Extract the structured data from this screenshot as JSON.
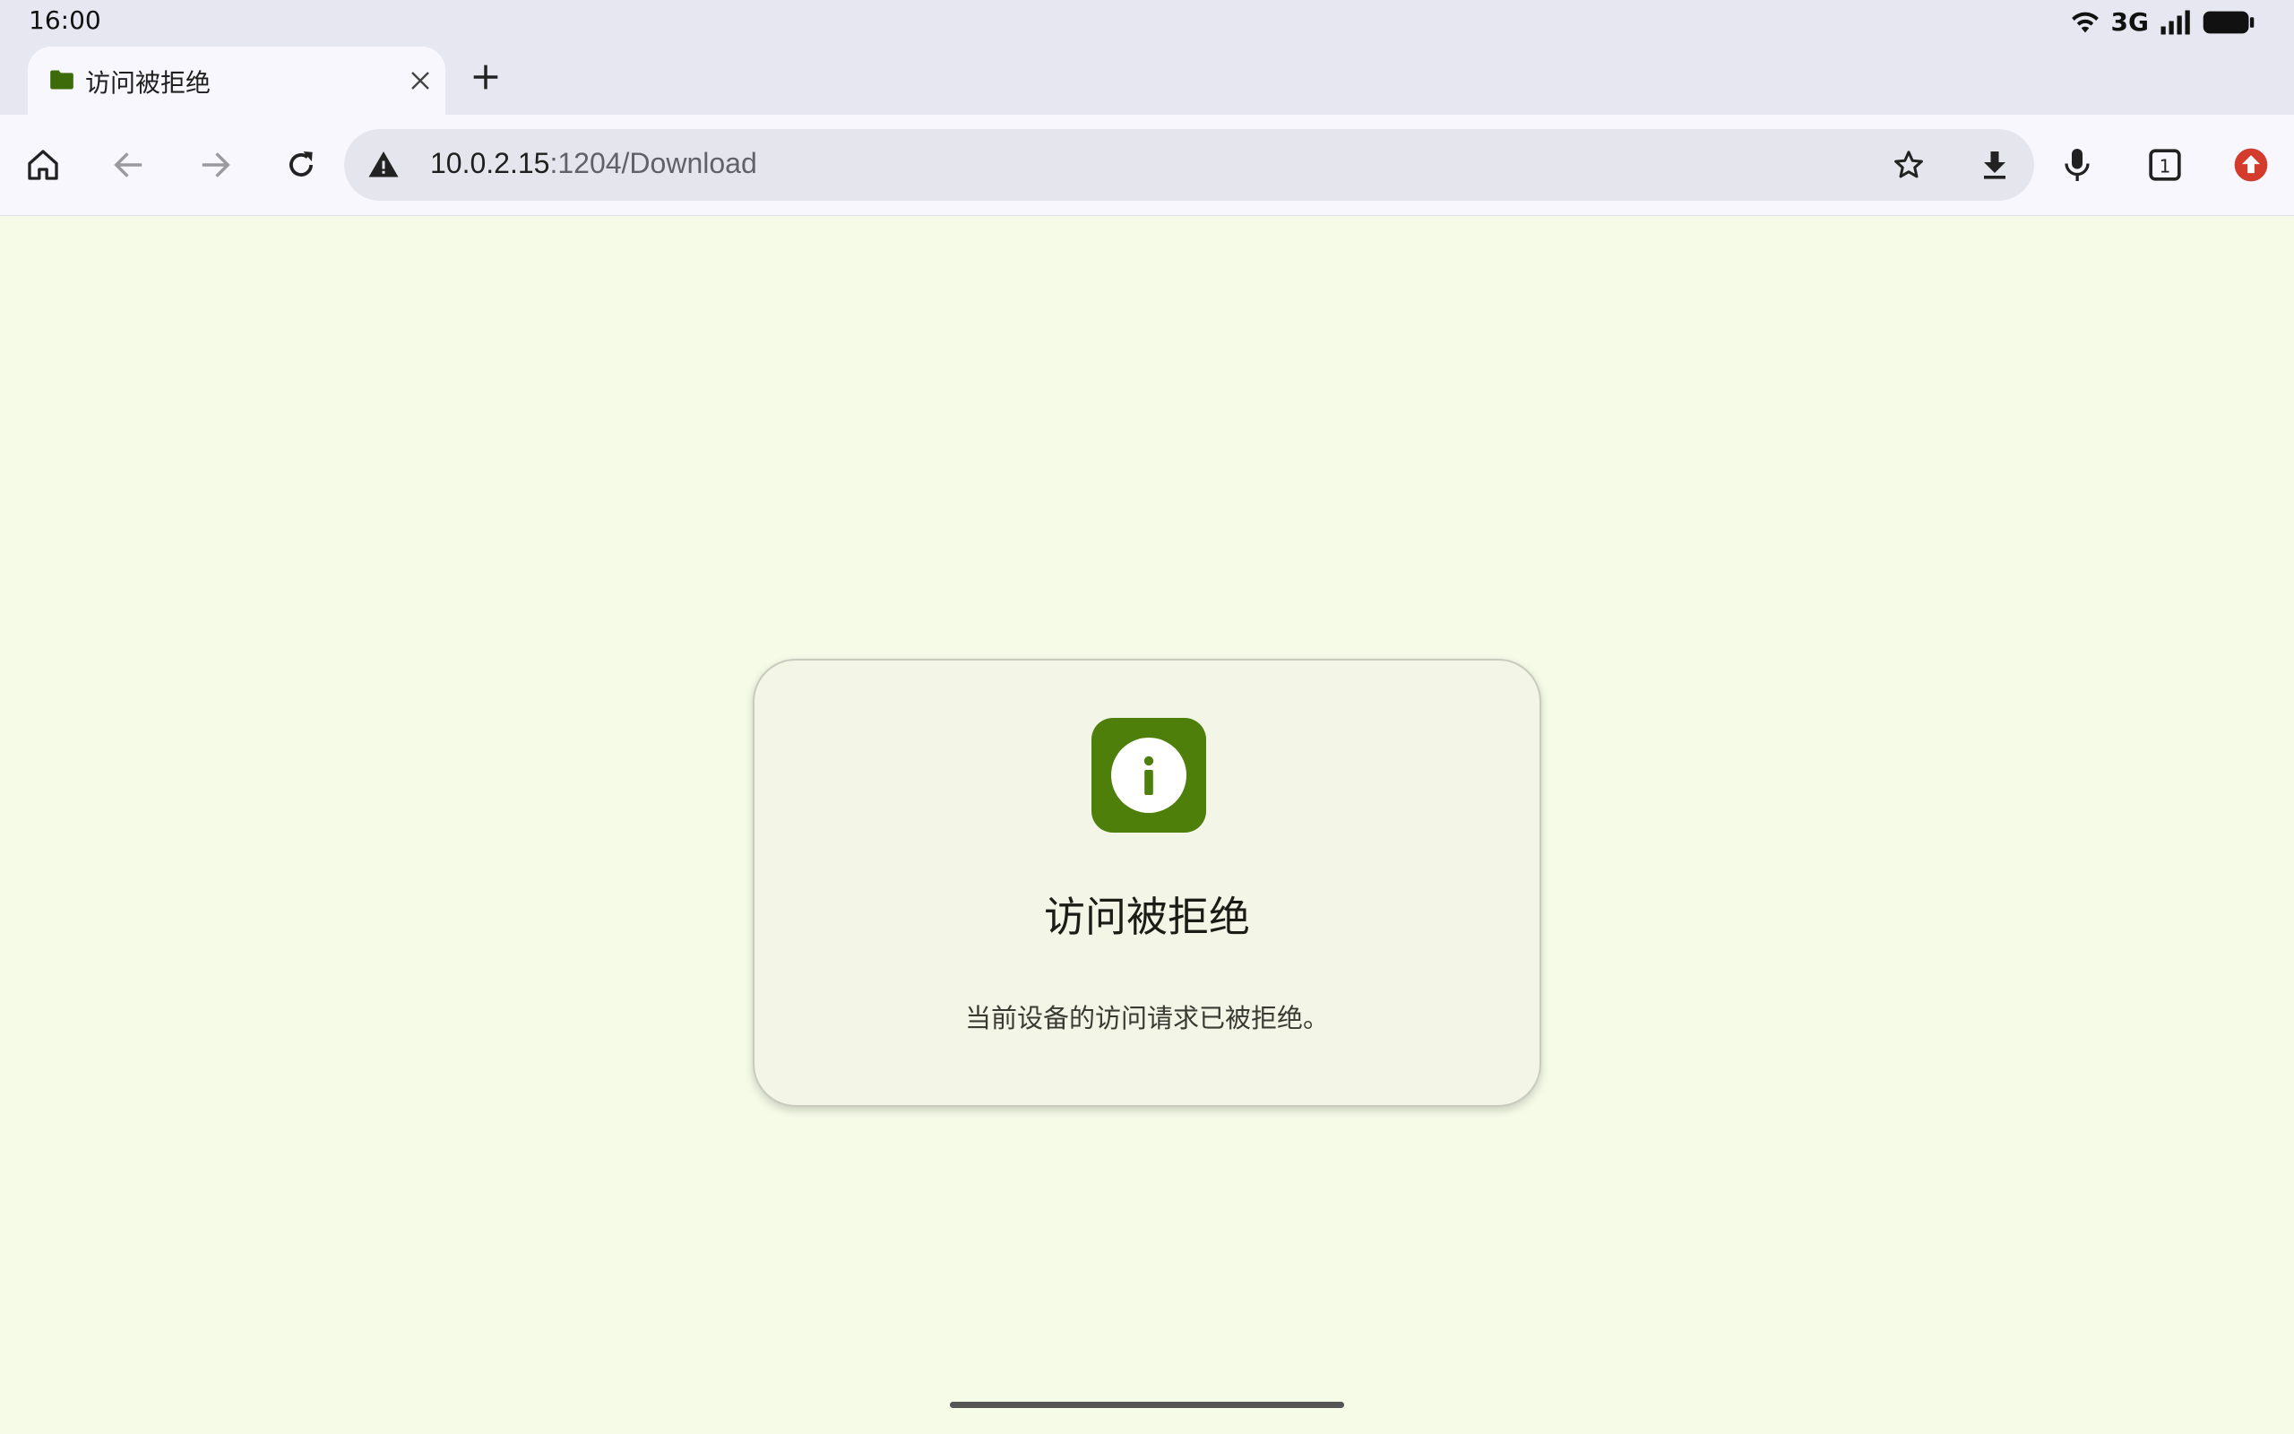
{
  "status_bar": {
    "time": "16:00",
    "network": "3G",
    "icons": [
      "wifi-icon",
      "signal-icon",
      "battery-icon"
    ]
  },
  "tab": {
    "title": "访问被拒绝",
    "favicon": "folder-icon",
    "favicon_color": "#3d6b0a"
  },
  "toolbar": {
    "url_host": "10.0.2.15",
    "url_rest": ":1204/Download",
    "tab_count": "1",
    "icons": [
      "home-icon",
      "back-icon",
      "forward-icon",
      "reload-icon",
      "not-secure-icon",
      "bookmark-star-icon",
      "download-icon",
      "microphone-icon",
      "tab-switcher-icon",
      "update-icon"
    ]
  },
  "card": {
    "title": "访问被拒绝",
    "message": "当前设备的访问请求已被拒绝。",
    "icon": "info-icon",
    "accent": "#4e7f0b"
  },
  "colors": {
    "page_background": "#f6fbe8",
    "chrome_background": "#e7e7f1",
    "update_badge": "#d33b2c"
  }
}
